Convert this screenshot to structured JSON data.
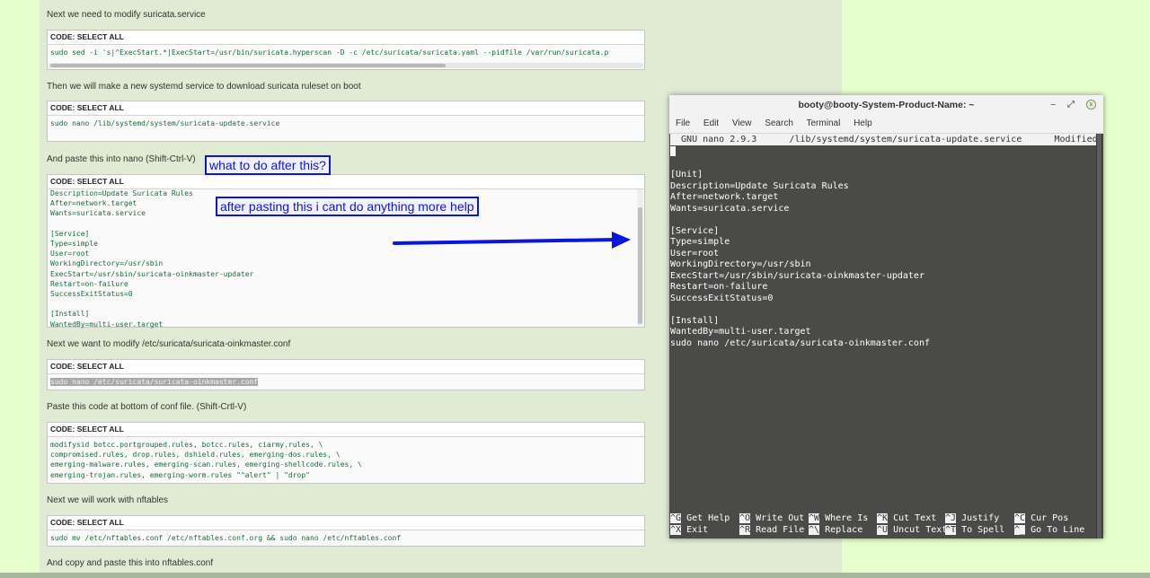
{
  "tutorial": {
    "para1": "Next we need to modify suricata.service",
    "code_header": "CODE: SELECT ALL",
    "code1": "sudo sed -i 's|^ExecStart.*|ExecStart=/usr/bin/suricata.hyperscan -D -c /etc/suricata/suricata.yaml --pidfile /var/run/suricata.p",
    "para2": "Then we will make a new systemd service to download suricata ruleset on boot",
    "code2": "sudo nano /lib/systemd/system/suricata-update.service",
    "para3": "And paste this into nano (Shift-Ctrl-V)",
    "code3": "Description=Update Suricata Rules\nAfter=network.target\nWants=suricata.service\n\n[Service]\nType=simple\nUser=root\nWorkingDirectory=/usr/sbin\nExecStart=/usr/sbin/suricata-oinkmaster-updater\nRestart=on-failure\nSuccessExitStatus=0\n\n[Install]\nWantedBy=multi-user.target",
    "para4": "Next we want to modify /etc/suricata/suricata-oinkmaster.conf",
    "code4": "sudo nano /etc/suricata/suricata-oinkmaster.conf",
    "para5": "Paste this code at bottom of conf file. (Shift-Crtl-V)",
    "code5": "modifysid botcc.portgrouped.rules, botcc.rules, ciarmy.rules, \\\ncompromised.rules, drop.rules, dshield.rules, emerging-dos.rules, \\\nemerging-malware.rules, emerging-scan.rules, emerging-shellcode.rules, \\\nemerging-trojan.rules, emerging-worm.rules \"^alert\" | \"drop\"",
    "para6": "Next we will work with nftables",
    "code6": "sudo mv /etc/nftables.conf /etc/nftables.conf.org && sudo nano /etc/nftables.conf",
    "para7": "And copy and paste this into nftables.conf"
  },
  "annotations": {
    "question": "what to do after this?",
    "help": "after pasting this i cant do anything more help",
    "arrow_color": "#0b17d8"
  },
  "terminal": {
    "title": "booty@booty-System-Product-Name: ~",
    "menu": [
      "File",
      "Edit",
      "View",
      "Search",
      "Terminal",
      "Help"
    ],
    "nano_header": "  GNU nano 2.9.3      /lib/systemd/system/suricata-update.service      Modified",
    "body": "[Unit]\nDescription=Update Suricata Rules\nAfter=network.target\nWants=suricata.service\n\n[Service]\nType=simple\nUser=root\nWorkingDirectory=/usr/sbin\nExecStart=/usr/sbin/suricata-oinkmaster-updater\nRestart=on-failure\nSuccessExitStatus=0\n\n[Install]\nWantedBy=multi-user.target\nsudo nano /etc/suricata/suricata-oinkmaster.conf",
    "shortcuts": [
      {
        "key": "^G",
        "label": "Get Help"
      },
      {
        "key": "^O",
        "label": "Write Out"
      },
      {
        "key": "^W",
        "label": "Where Is"
      },
      {
        "key": "^K",
        "label": "Cut Text"
      },
      {
        "key": "^J",
        "label": "Justify"
      },
      {
        "key": "^C",
        "label": "Cur Pos"
      },
      {
        "key": "^X",
        "label": "Exit"
      },
      {
        "key": "^R",
        "label": "Read File"
      },
      {
        "key": "^\\",
        "label": "Replace"
      },
      {
        "key": "^U",
        "label": "Uncut Text"
      },
      {
        "key": "^T",
        "label": "To Spell"
      },
      {
        "key": "^_",
        "label": "Go To Line"
      }
    ]
  }
}
